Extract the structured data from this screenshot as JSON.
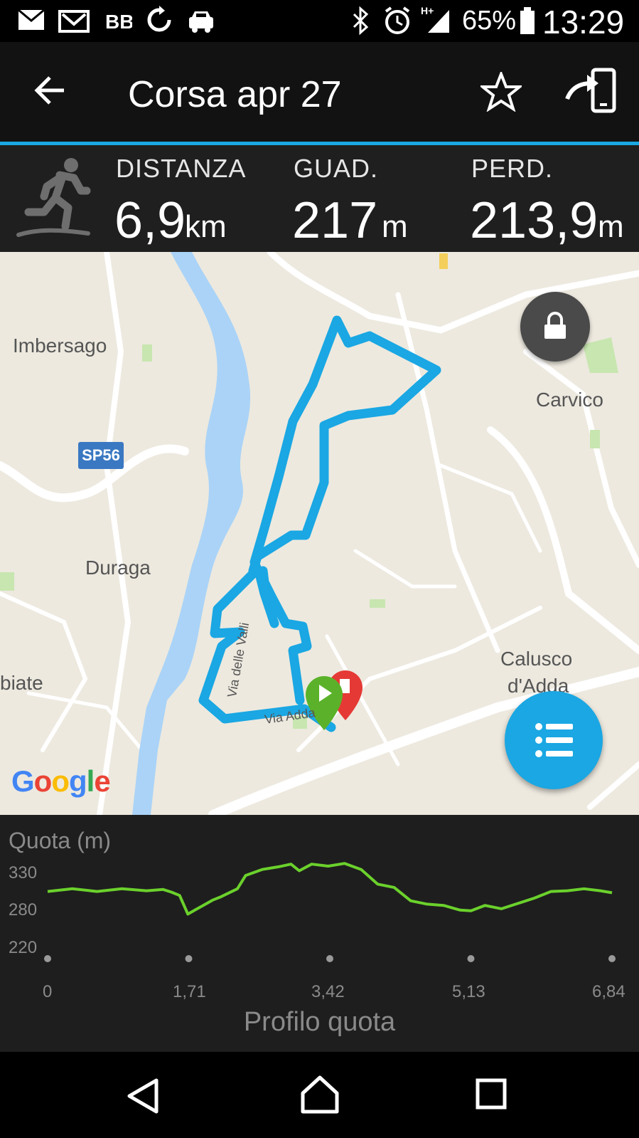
{
  "status_bar": {
    "battery_percent": "65%",
    "time": "13:29",
    "icons": [
      "mail-icon",
      "gmail-icon",
      "bb-icon",
      "sync-icon",
      "car-icon",
      "bluetooth-icon",
      "alarm-icon",
      "signal-icon",
      "battery-icon"
    ]
  },
  "app_bar": {
    "title": "Corsa apr 27",
    "back_icon": "arrow-back-icon",
    "favorite_icon": "star-outline-icon",
    "share_icon": "send-to-device-icon"
  },
  "stats": {
    "activity_icon": "running-icon",
    "distance": {
      "label": "DISTANZA",
      "value": "6,9",
      "unit": "km"
    },
    "gain": {
      "label": "GUAD.",
      "value": "217",
      "unit": "m"
    },
    "loss": {
      "label": "PERD.",
      "value": "213,9",
      "unit": "m"
    }
  },
  "map": {
    "places": {
      "imbersago": "Imbersago",
      "carvico": "Carvico",
      "duraga": "Duraga",
      "calusco1": "Calusco",
      "calusco2": "d'Adda",
      "biate": "biate",
      "via_valli": "Via delle Valli",
      "via_adda": "Via Adda"
    },
    "road_badge": "SP56",
    "attribution": "Google",
    "lock_icon": "lock-icon",
    "menu_icon": "list-icon",
    "colors": {
      "route": "#1aa7e3",
      "water": "#aad3f7",
      "land": "#ede9df",
      "start": "#5bb22a",
      "end": "#e53935"
    }
  },
  "elevation": {
    "title": "Quota (m)",
    "caption": "Profilo quota",
    "chart_data": {
      "type": "line",
      "xlabel": "",
      "ylabel": "Quota (m)",
      "x_ticks": [
        "0",
        "1,71",
        "3,42",
        "5,13",
        "6,84"
      ],
      "y_ticks": [
        "330",
        "280",
        "220"
      ],
      "xlim": [
        0,
        6.84
      ],
      "ylim": [
        220,
        330
      ],
      "line_color": "#6bd12c",
      "series": [
        {
          "x": [
            0,
            0.3,
            0.6,
            0.9,
            1.2,
            1.4,
            1.5,
            1.6,
            1.7,
            1.8,
            1.9,
            2.0,
            2.1,
            2.3,
            2.4,
            2.6,
            2.8,
            2.95,
            3.05,
            3.2,
            3.4,
            3.6,
            3.8,
            4.0,
            4.2,
            4.4,
            4.6,
            4.8,
            5.0,
            5.13,
            5.3,
            5.5,
            5.7,
            5.9,
            6.1,
            6.3,
            6.5,
            6.7,
            6.84
          ],
          "y": [
            276,
            280,
            276,
            280,
            277,
            279,
            275,
            270,
            242,
            249,
            256,
            263,
            268,
            280,
            300,
            309,
            313,
            317,
            307,
            317,
            314,
            318,
            309,
            287,
            282,
            262,
            257,
            255,
            248,
            247,
            255,
            250,
            258,
            266,
            276,
            277,
            280,
            277,
            274
          ]
        }
      ]
    }
  },
  "nav_bar": {
    "back_icon": "nav-back-icon",
    "home_icon": "nav-home-icon",
    "recents_icon": "nav-recents-icon"
  }
}
